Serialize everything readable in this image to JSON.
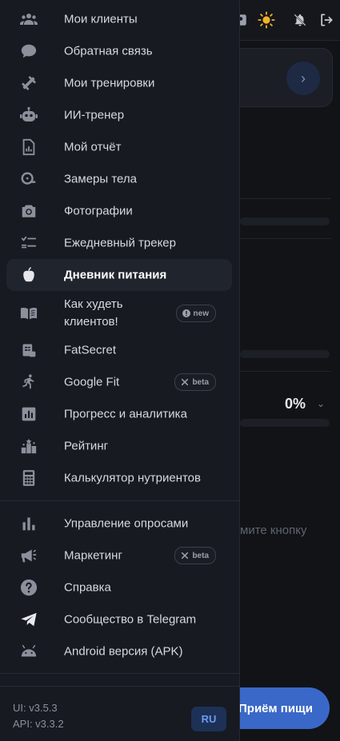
{
  "background": {
    "percent_value": "0%",
    "hint_text": "мите кнопку",
    "fab_label": "Приём пищи",
    "topbar_icons": [
      "scale-icon",
      "sun-icon",
      "bell-off-icon",
      "logout-icon"
    ]
  },
  "menu": {
    "group1": [
      {
        "label": "Мои клиенты",
        "icon": "people-icon"
      },
      {
        "label": "Обратная связь",
        "icon": "chat-icon"
      },
      {
        "label": "Мои тренировки",
        "icon": "dumbbell-icon"
      },
      {
        "label": "ИИ-тренер",
        "icon": "robot-icon"
      },
      {
        "label": "Мой отчёт",
        "icon": "report-icon"
      },
      {
        "label": "Замеры тела",
        "icon": "measure-icon"
      },
      {
        "label": "Фотографии",
        "icon": "camera-icon"
      },
      {
        "label": "Ежедневный трекер",
        "icon": "checklist-icon"
      },
      {
        "label": "Дневник питания",
        "icon": "apple-icon",
        "active": true
      },
      {
        "label": "Как худеть клиентов!",
        "icon": "book-icon",
        "badge": "new"
      },
      {
        "label": "FatSecret",
        "icon": "fatsecret-icon"
      },
      {
        "label": "Google Fit",
        "icon": "runner-icon",
        "badge": "beta"
      },
      {
        "label": "Прогресс и аналитика",
        "icon": "analytics-icon"
      },
      {
        "label": "Рейтинг",
        "icon": "leaderboard-icon"
      },
      {
        "label": "Калькулятор нутриентов",
        "icon": "calculator-icon"
      }
    ],
    "group2": [
      {
        "label": "Управление опросами",
        "icon": "bar-chart-icon"
      },
      {
        "label": "Маркетинг",
        "icon": "megaphone-icon",
        "badge": "beta"
      },
      {
        "label": "Справка",
        "icon": "help-icon"
      },
      {
        "label": "Сообщество в Telegram",
        "icon": "telegram-icon"
      },
      {
        "label": "Android версия (APK)",
        "icon": "android-icon"
      }
    ]
  },
  "footer": {
    "ui_version": "UI: v3.5.3",
    "api_version": "API: v3.3.2",
    "language": "RU"
  },
  "colors": {
    "drawer_bg": "#171a21",
    "active_item_bg": "#20242d",
    "accent": "#3a68c8",
    "lang_text": "#6d9bf1"
  }
}
